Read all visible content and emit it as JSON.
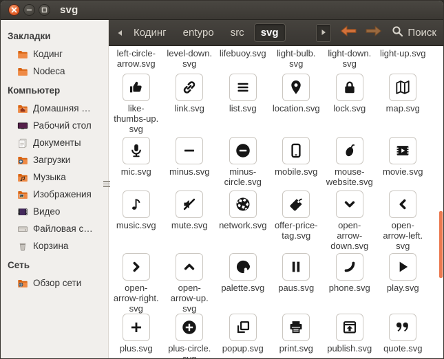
{
  "window": {
    "title": "svg"
  },
  "sidebar": {
    "sections": [
      {
        "heading": "Закладки",
        "items": [
          {
            "id": "koding",
            "label": "Кодинг",
            "icon": "folder"
          },
          {
            "id": "nodeca",
            "label": "Nodeca",
            "icon": "folder"
          }
        ]
      },
      {
        "heading": "Компьютер",
        "items": [
          {
            "id": "home",
            "label": "Домашняя …",
            "icon": "home-folder"
          },
          {
            "id": "desktop",
            "label": "Рабочий стол",
            "icon": "desktop"
          },
          {
            "id": "documents",
            "label": "Документы",
            "icon": "documents"
          },
          {
            "id": "downloads",
            "label": "Загрузки",
            "icon": "downloads-folder"
          },
          {
            "id": "music",
            "label": "Музыка",
            "icon": "music-folder"
          },
          {
            "id": "pictures",
            "label": "Изображения",
            "icon": "images-folder"
          },
          {
            "id": "videos",
            "label": "Видео",
            "icon": "video"
          },
          {
            "id": "filesystem",
            "label": "Файловая с…",
            "icon": "filesystem"
          },
          {
            "id": "trash",
            "label": "Корзина",
            "icon": "trash"
          }
        ]
      },
      {
        "heading": "Сеть",
        "items": [
          {
            "id": "network-browse",
            "label": "Обзор сети",
            "icon": "network-folder"
          }
        ]
      }
    ]
  },
  "toolbar": {
    "breadcrumbs": [
      {
        "id": "koding",
        "label": "Кодинг",
        "active": false
      },
      {
        "id": "entypo",
        "label": "entypo",
        "active": false
      },
      {
        "id": "src",
        "label": "src",
        "active": false
      },
      {
        "id": "svg",
        "label": "svg",
        "active": true
      }
    ],
    "search_label": "Поиск"
  },
  "grid": {
    "rows": [
      {
        "cells": [
          {
            "label": "left-circle-\narrow.svg",
            "label_only": true
          },
          {
            "label": "level-down.\nsvg",
            "label_only": true
          },
          {
            "label": "lifebuoy.svg",
            "label_only": true
          },
          {
            "label": "light-bulb.\nsvg",
            "label_only": true
          },
          {
            "label": "light-down.\nsvg",
            "label_only": true
          },
          {
            "label": "light-up.svg",
            "label_only": true
          }
        ]
      },
      {
        "cells": [
          {
            "label": "like-\nthumbs-up.\nsvg",
            "icon": "thumbs-up"
          },
          {
            "label": "link.svg",
            "icon": "link"
          },
          {
            "label": "list.svg",
            "icon": "list"
          },
          {
            "label": "location.svg",
            "icon": "location-pin"
          },
          {
            "label": "lock.svg",
            "icon": "lock"
          },
          {
            "label": "map.svg",
            "icon": "map"
          }
        ]
      },
      {
        "cells": [
          {
            "label": "mic.svg",
            "icon": "microphone"
          },
          {
            "label": "minus.svg",
            "icon": "minus"
          },
          {
            "label": "minus-\ncircle.svg",
            "icon": "minus-circle"
          },
          {
            "label": "mobile.svg",
            "icon": "mobile"
          },
          {
            "label": "mouse-\nwebsite.svg",
            "icon": "mouse"
          },
          {
            "label": "movie.svg",
            "icon": "movie"
          }
        ]
      },
      {
        "cells": [
          {
            "label": "music.svg",
            "icon": "music-note"
          },
          {
            "label": "mute.svg",
            "icon": "mute"
          },
          {
            "label": "network.svg",
            "icon": "globe"
          },
          {
            "label": "offer-price-\ntag.svg",
            "icon": "price-tag"
          },
          {
            "label": "open-\narrow-\ndown.svg",
            "icon": "chevron-down"
          },
          {
            "label": "open-\narrow-left.\nsvg",
            "icon": "chevron-left"
          }
        ]
      },
      {
        "cells": [
          {
            "label": "open-\narrow-right.\nsvg",
            "icon": "chevron-right"
          },
          {
            "label": "open-\narrow-up.\nsvg",
            "icon": "chevron-up"
          },
          {
            "label": "palette.svg",
            "icon": "palette"
          },
          {
            "label": "paus.svg",
            "icon": "pause"
          },
          {
            "label": "phone.svg",
            "icon": "phone"
          },
          {
            "label": "play.svg",
            "icon": "play"
          }
        ]
      },
      {
        "cells": [
          {
            "label": "plus.svg",
            "icon": "plus"
          },
          {
            "label": "plus-circle.\nsvg",
            "icon": "plus-circle"
          },
          {
            "label": "popup.svg",
            "icon": "popup"
          },
          {
            "label": "print.svg",
            "icon": "printer"
          },
          {
            "label": "publish.svg",
            "icon": "publish"
          },
          {
            "label": "quote.svg",
            "icon": "quote"
          }
        ]
      }
    ]
  },
  "colors": {
    "accent_orange": "#EC7950",
    "close_button": "#E0571F",
    "titlebar_bg": "#3B3833",
    "toolbar_bg": "#393632",
    "sidebar_bg": "#F1EFEC",
    "content_bg": "#FFFFFF",
    "folder_orange": "#EF8A45"
  }
}
